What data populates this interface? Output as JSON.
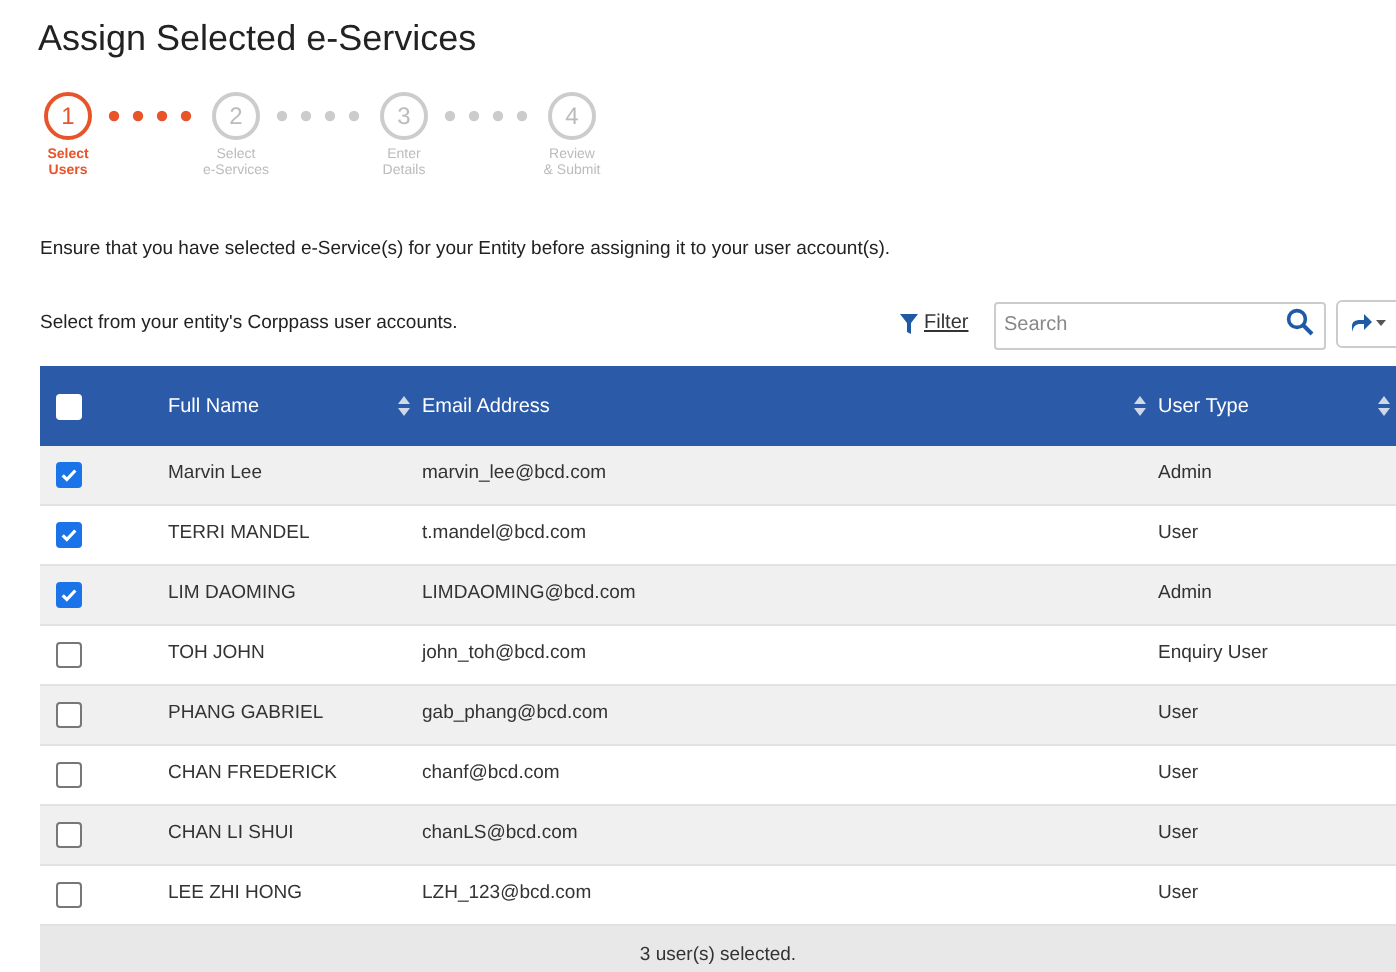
{
  "title": "Assign Selected e-Services",
  "steps": [
    {
      "number": "1",
      "label": "Select\nUsers",
      "selected": true
    },
    {
      "number": "2",
      "label": "Select\ne-Services",
      "selected": false
    },
    {
      "number": "3",
      "label": "Enter\nDetails",
      "selected": false
    },
    {
      "number": "4",
      "label": "Review\n& Submit",
      "selected": false
    }
  ],
  "notice": "Ensure that you have selected e-Service(s) for your Entity before assigning it to your user account(s).",
  "instruction": "Select from your entity's Corppass user accounts.",
  "filter": "Filter",
  "search": {
    "placeholder": "Search"
  },
  "table": {
    "select_all_checked": false,
    "columns": [
      "Full Name",
      "Email Address",
      "User Type"
    ],
    "rows": [
      {
        "name": "Marvin Lee",
        "email": "marvin_lee@bcd.com",
        "type": "Admin",
        "checked": true
      },
      {
        "name": "TERRI MANDEL",
        "email": "t.mandel@bcd.com",
        "type": "User",
        "checked": true
      },
      {
        "name": "LIM DAOMING",
        "email": "LIMDAOMING@bcd.com",
        "type": "Admin",
        "checked": true
      },
      {
        "name": "TOH JOHN",
        "email": "john_toh@bcd.com",
        "type": "Enquiry User",
        "checked": false
      },
      {
        "name": "PHANG GABRIEL",
        "email": "gab_phang@bcd.com",
        "type": "User",
        "checked": false
      },
      {
        "name": "CHAN FREDERICK",
        "email": "chanf@bcd.com",
        "type": "User",
        "checked": false
      },
      {
        "name": "CHAN LI SHUI",
        "email": "chanLS@bcd.com",
        "type": "User",
        "checked": false
      },
      {
        "name": "LEE ZHI HONG",
        "email": "LZH_123@bcd.com",
        "type": "User",
        "checked": false
      }
    ],
    "footer": "3 user(s) selected."
  }
}
